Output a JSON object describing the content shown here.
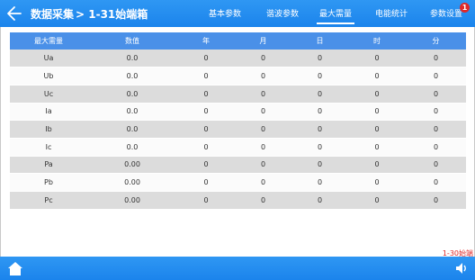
{
  "header": {
    "title": "数据采集",
    "subtitle": "> 1-31始端箱",
    "tabs": [
      {
        "label": "基本参数",
        "active": false
      },
      {
        "label": "谐波参数",
        "active": false
      },
      {
        "label": "最大需量",
        "active": true
      },
      {
        "label": "电能统计",
        "active": false
      },
      {
        "label": "参数设置",
        "active": false
      }
    ],
    "badge": "1"
  },
  "table": {
    "columns": [
      "最大需量",
      "数值",
      "年",
      "月",
      "日",
      "时",
      "分"
    ],
    "rows": [
      [
        "Ua",
        "0.0",
        "0",
        "0",
        "0",
        "0",
        "0"
      ],
      [
        "Ub",
        "0.0",
        "0",
        "0",
        "0",
        "0",
        "0"
      ],
      [
        "Uc",
        "0.0",
        "0",
        "0",
        "0",
        "0",
        "0"
      ],
      [
        "Ia",
        "0.0",
        "0",
        "0",
        "0",
        "0",
        "0"
      ],
      [
        "Ib",
        "0.0",
        "0",
        "0",
        "0",
        "0",
        "0"
      ],
      [
        "Ic",
        "0.0",
        "0",
        "0",
        "0",
        "0",
        "0"
      ],
      [
        "Pa",
        "0.00",
        "0",
        "0",
        "0",
        "0",
        "0"
      ],
      [
        "Pb",
        "0.00",
        "0",
        "0",
        "0",
        "0",
        "0"
      ],
      [
        "Pc",
        "0.00",
        "0",
        "0",
        "0",
        "0",
        "0"
      ]
    ]
  },
  "device_link": "1-30始端",
  "icons": {
    "back": "back-arrow-icon",
    "home": "home-icon",
    "sound": "speaker-icon"
  },
  "colors": {
    "header_blue": "#1b84ec",
    "table_header": "#4a90e8",
    "row_gray": "#dcdcdc",
    "alert_red": "#e02828"
  }
}
